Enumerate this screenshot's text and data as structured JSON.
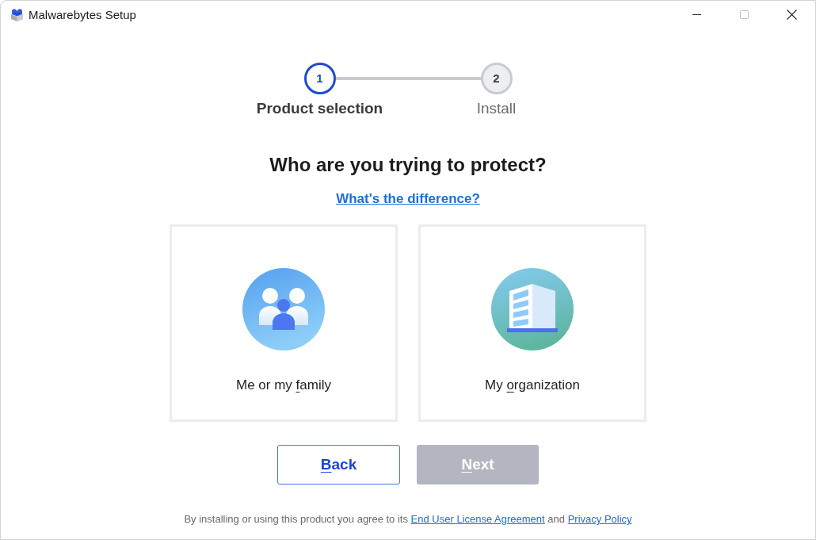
{
  "window": {
    "title": "Malwarebytes Setup",
    "controls": [
      {
        "kind": "minimize",
        "disabled": false
      },
      {
        "kind": "maximize",
        "disabled": true
      },
      {
        "kind": "close",
        "disabled": false
      }
    ]
  },
  "steps": [
    {
      "number": "1",
      "label": "Product selection",
      "selected": true
    },
    {
      "number": "2",
      "label": "Install",
      "selected": false
    }
  ],
  "heading": "Who are you trying to protect?",
  "help_link": "What's the difference?",
  "options": [
    {
      "kind": "family",
      "selected": false,
      "label_before": "Me or my ",
      "access_key": "f",
      "label_after": "amily"
    },
    {
      "kind": "organization",
      "selected": false,
      "label_before": "My ",
      "access_key": "o",
      "label_after": "rganization"
    }
  ],
  "buttons": [
    {
      "kind": "secondary",
      "disabled": false,
      "access_key": "B",
      "label_after": "ack"
    },
    {
      "kind": "primary",
      "disabled": true,
      "access_key": "N",
      "label_after": "ext"
    }
  ],
  "footer": {
    "parts": [
      {
        "kind": "text",
        "text": "By installing or using this product you agree to its"
      },
      {
        "kind": "link",
        "text": "End User License Agreement"
      },
      {
        "kind": "text",
        "text": "and"
      },
      {
        "kind": "link",
        "text": "Privacy Policy"
      }
    ]
  }
}
